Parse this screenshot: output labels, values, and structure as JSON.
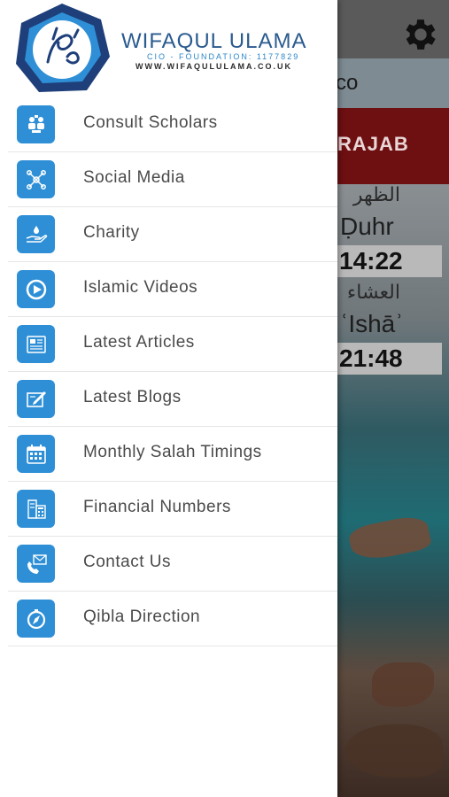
{
  "background": {
    "location_text": "co",
    "month_text": "RAJAB",
    "prayers": [
      {
        "arabic": "الظهر",
        "english": "Ḍuhr",
        "time": "14:22"
      },
      {
        "arabic": "العشاء",
        "english": "ʿIshāʾ",
        "time": "21:48"
      }
    ]
  },
  "drawer": {
    "logo": {
      "title": "WIFAQUL ULAMA",
      "subtitle": "CIO - FOUNDATION: 1177829",
      "url": "WWW.WIFAQULULAMA.CO.UK"
    },
    "menu": [
      {
        "label": "Consult Scholars",
        "icon": "consult-icon"
      },
      {
        "label": "Social Media",
        "icon": "share-network-icon"
      },
      {
        "label": "Charity",
        "icon": "charity-hand-icon"
      },
      {
        "label": "Islamic Videos",
        "icon": "play-icon"
      },
      {
        "label": "Latest Articles",
        "icon": "newspaper-icon"
      },
      {
        "label": "Latest Blogs",
        "icon": "edit-note-icon"
      },
      {
        "label": "Monthly Salah Timings",
        "icon": "calendar-icon"
      },
      {
        "label": "Financial Numbers",
        "icon": "calculator-icon"
      },
      {
        "label": "Contact Us",
        "icon": "contact-icon"
      },
      {
        "label": "Qibla Direction",
        "icon": "compass-icon"
      }
    ]
  },
  "colors": {
    "accent": "#2e8fd6",
    "brand_text": "#2a5b8f",
    "banner_red": "#6e0f12"
  }
}
